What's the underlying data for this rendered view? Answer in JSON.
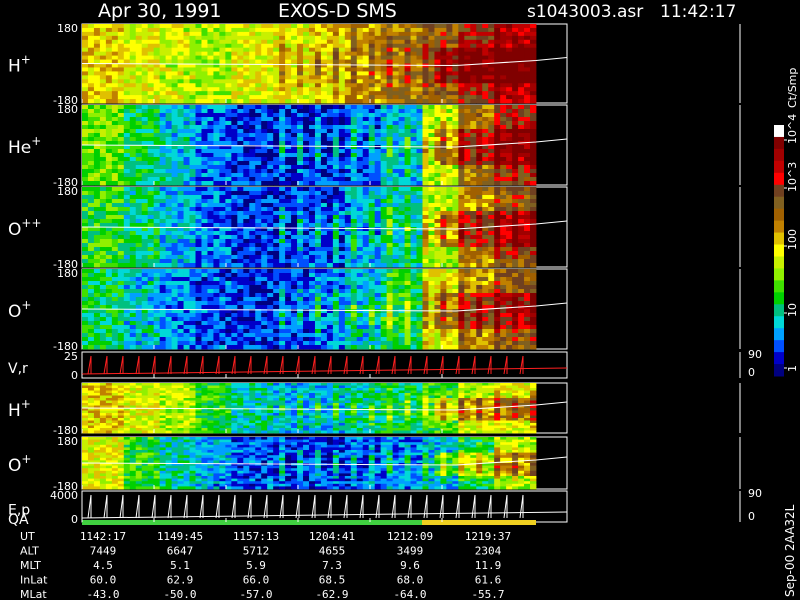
{
  "header": {
    "date": "Apr 30, 1991",
    "instrument": "EXOS-D SMS",
    "file": "s1043003.asr",
    "time": "11:42:17"
  },
  "colorbar": {
    "unit_label": "Ct/Smp",
    "tick_labels": [
      "1",
      "10",
      "100",
      "10^3",
      "10^4"
    ],
    "colors": [
      "#000080",
      "#0000c8",
      "#0050ff",
      "#00a0ff",
      "#00d8d8",
      "#00c080",
      "#00d000",
      "#40e000",
      "#90f000",
      "#c8f000",
      "#ffff00",
      "#e0c000",
      "#c08000",
      "#a06000",
      "#806020",
      "#704020",
      "#ff0000",
      "#c00000",
      "#a00000",
      "#800000",
      "#ffffff"
    ]
  },
  "side_label": "Sep-00 2AA32L",
  "chart_data": {
    "type": "heatmap",
    "title": "Apr 30, 1991 EXOS-D SMS s1043003.asr 11:42:17",
    "time_ticks": [
      "1142:17",
      "1149:45",
      "1157:13",
      "1204:41",
      "1212:09",
      "1219:37"
    ],
    "panels": [
      {
        "label": "H",
        "sup": "+",
        "ymax": "180",
        "ymin": "-180",
        "kind": "spectro",
        "profile": [
          0.55,
          0.5,
          0.48,
          0.45,
          0.5,
          0.52,
          0.55,
          0.6,
          0.65,
          0.7,
          0.8,
          0.88
        ]
      },
      {
        "label": "He",
        "sup": "+",
        "ymax": "180",
        "ymin": "-180",
        "kind": "spectro",
        "profile": [
          0.4,
          0.3,
          0.22,
          0.15,
          0.1,
          0.08,
          0.08,
          0.12,
          0.2,
          0.45,
          0.65,
          0.78
        ]
      },
      {
        "label": "O",
        "sup": "++",
        "ymax": "180",
        "ymin": "-180",
        "kind": "spectro",
        "profile": [
          0.35,
          0.28,
          0.2,
          0.14,
          0.1,
          0.1,
          0.12,
          0.18,
          0.25,
          0.45,
          0.62,
          0.72
        ]
      },
      {
        "label": "O",
        "sup": "+",
        "ymax": "180",
        "ymin": "-180",
        "kind": "spectro",
        "profile": [
          0.3,
          0.22,
          0.16,
          0.12,
          0.1,
          0.1,
          0.14,
          0.22,
          0.32,
          0.5,
          0.62,
          0.7
        ]
      },
      {
        "label": "V,r",
        "sup": "",
        "ymax": "25",
        "ymin": "0",
        "kind": "line",
        "right_top": "90",
        "right_bottom": "0"
      },
      {
        "label": "H",
        "sup": "+",
        "ymax": "",
        "ymin": "-180",
        "kind": "spectro",
        "profile": [
          0.55,
          0.5,
          0.45,
          0.35,
          0.25,
          0.2,
          0.2,
          0.25,
          0.3,
          0.35,
          0.45,
          0.5
        ]
      },
      {
        "label": "O",
        "sup": "+",
        "ymax": "180",
        "ymin": "-180",
        "kind": "spectro",
        "profile": [
          0.5,
          0.35,
          0.25,
          0.18,
          0.12,
          0.1,
          0.1,
          0.12,
          0.15,
          0.2,
          0.3,
          0.45
        ]
      },
      {
        "label": "E,p",
        "sup": "",
        "ymax": "4000",
        "ymin": "0",
        "kind": "line",
        "right_top": "90",
        "right_bottom": "0"
      }
    ],
    "qa_label": "QA",
    "orbit_rows": [
      {
        "name": "UT",
        "values": [
          "1142:17",
          "1149:45",
          "1157:13",
          "1204:41",
          "1212:09",
          "1219:37"
        ]
      },
      {
        "name": "ALT",
        "values": [
          "7449",
          "6647",
          "5712",
          "4655",
          "3499",
          "2304"
        ]
      },
      {
        "name": "MLT",
        "values": [
          "4.5",
          "5.1",
          "5.9",
          "7.3",
          "9.6",
          "11.9"
        ]
      },
      {
        "name": "InLat",
        "values": [
          "60.0",
          "62.9",
          "66.0",
          "68.5",
          "68.0",
          "61.6"
        ]
      },
      {
        "name": "MLat",
        "values": [
          "-43.0",
          "-50.0",
          "-57.0",
          "-62.9",
          "-64.0",
          "-55.7"
        ]
      }
    ]
  }
}
